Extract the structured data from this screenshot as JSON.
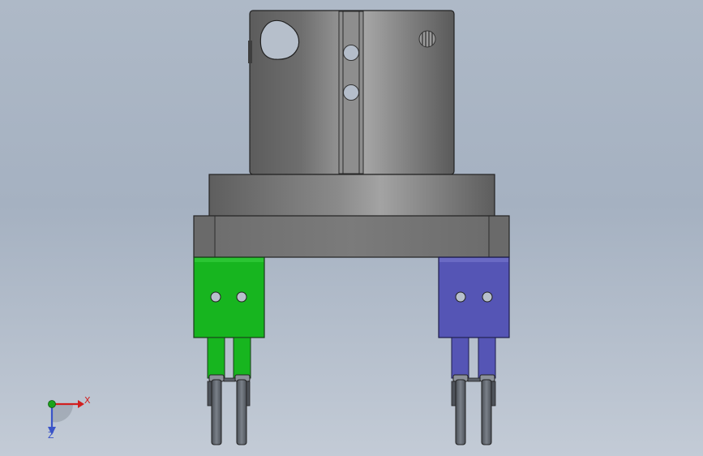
{
  "viewport": {
    "background_top": "#aeb9c7",
    "background_bottom": "#c3cbd6"
  },
  "model": {
    "body_color": "#7a7a7a",
    "left_jaw_color": "#17b51f",
    "right_jaw_color": "#5555b5",
    "finger_color": "#5b6068"
  },
  "triad": {
    "x_label": "X",
    "z_label": "Z",
    "x_color": "#d11f1f",
    "y_color": "#1aa31a",
    "z_color": "#3a54c8"
  }
}
